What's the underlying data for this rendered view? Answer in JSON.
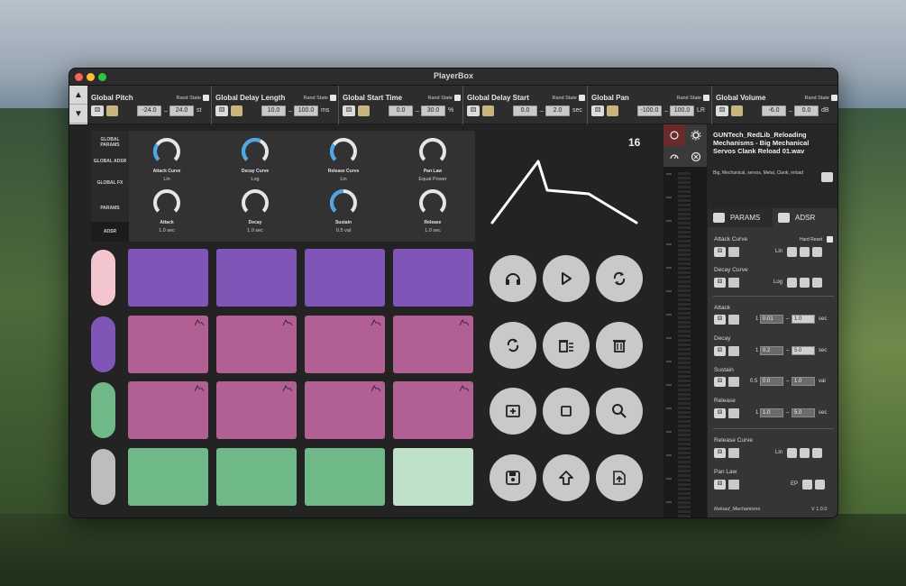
{
  "window": {
    "title": "PlayerBox"
  },
  "globals": [
    {
      "title": "Global Pitch",
      "rand_label": "Rand State",
      "min": "-24.0",
      "max": "24.0",
      "unit": "st"
    },
    {
      "title": "Global Delay Length",
      "rand_label": "Rand State",
      "min": "10.0",
      "max": "100.0",
      "unit": "ms"
    },
    {
      "title": "Global Start Time",
      "rand_label": "Rand State",
      "min": "0.0",
      "max": "30.0",
      "unit": "%"
    },
    {
      "title": "Global Delay Start",
      "rand_label": "Rand State",
      "min": "0.0",
      "max": "2.0",
      "unit": "sec"
    },
    {
      "title": "Global Pan",
      "rand_label": "Rand State",
      "min": "-100.0",
      "max": "100.0",
      "unit": "LR"
    },
    {
      "title": "Global Volume",
      "rand_label": "Rand State",
      "min": "-6.0",
      "max": "0.0",
      "unit": "dB"
    }
  ],
  "side_tabs": [
    {
      "label": "GLOBAL PARAMS"
    },
    {
      "label": "GLOBAL ADSR"
    },
    {
      "label": "GLOBAL FX"
    },
    {
      "label": "PARAMS"
    },
    {
      "label": "ADSR"
    }
  ],
  "knobs": [
    {
      "label": "Attack Curve",
      "value": "Lin",
      "level": 0.3
    },
    {
      "label": "Decay Curve",
      "value": "Log",
      "level": 0.6
    },
    {
      "label": "Release Curve",
      "value": "Lin",
      "level": 0.3
    },
    {
      "label": "Pan Law",
      "value": "Equal Power",
      "level": 0.0
    },
    {
      "label": "Attack",
      "value": "1.0 sec",
      "level": 0.0
    },
    {
      "label": "Decay",
      "value": "1.0 sec",
      "level": 0.0
    },
    {
      "label": "Sustain",
      "value": "0.5 val",
      "level": 0.5
    },
    {
      "label": "Release",
      "value": "1.0 sec",
      "level": 0.0
    }
  ],
  "pad_count": "16",
  "pad_colors": {
    "row1": "#7f55b8",
    "row2": "#b25f93",
    "row3": "#b25f93",
    "row4": "#6fb888",
    "row4_last": "#bfe0c9",
    "pill1": "#f2c5cf",
    "pill2": "#7f55b8",
    "pill3": "#6fb888",
    "pill4": "#bdbdbd"
  },
  "file": {
    "name": "GUNTech_RedLib_Reloading Mechanisms - Big Mechanical Servos Clank Reload 01.wav",
    "tags": "Big, Mechanical, servos, Metal, Clank, reload"
  },
  "right_tabs": {
    "params": "PARAMS",
    "adsr": "ADSR"
  },
  "adsr": {
    "attack_curve": "Attack Curve",
    "hard_reset": "Hard Reset",
    "attack_curve_value": "Lin",
    "decay_curve": "Decay Curve",
    "decay_curve_value": "Log",
    "attack": "Attack",
    "attack_mult": "1",
    "attack_min": "0.01",
    "attack_max": "1.0",
    "attack_unit": "sec",
    "decay": "Decay",
    "decay_mult": "1",
    "decay_min": "0.2",
    "decay_max": "5.0",
    "decay_unit": "sec",
    "sustain": "Sustain",
    "sustain_mult": "0.5",
    "sustain_min": "0.0",
    "sustain_max": "1.0",
    "sustain_unit": "val",
    "release": "Release",
    "release_mult": "1",
    "release_min": "1.0",
    "release_max": "5.0",
    "release_unit": "sec",
    "release_curve": "Release Curve",
    "release_curve_value": "Lin",
    "pan_law": "Pan Law",
    "pan_law_value": "EP"
  },
  "footer": {
    "preset": "Reload_Mechanisms",
    "version": "V 1.0.0"
  }
}
